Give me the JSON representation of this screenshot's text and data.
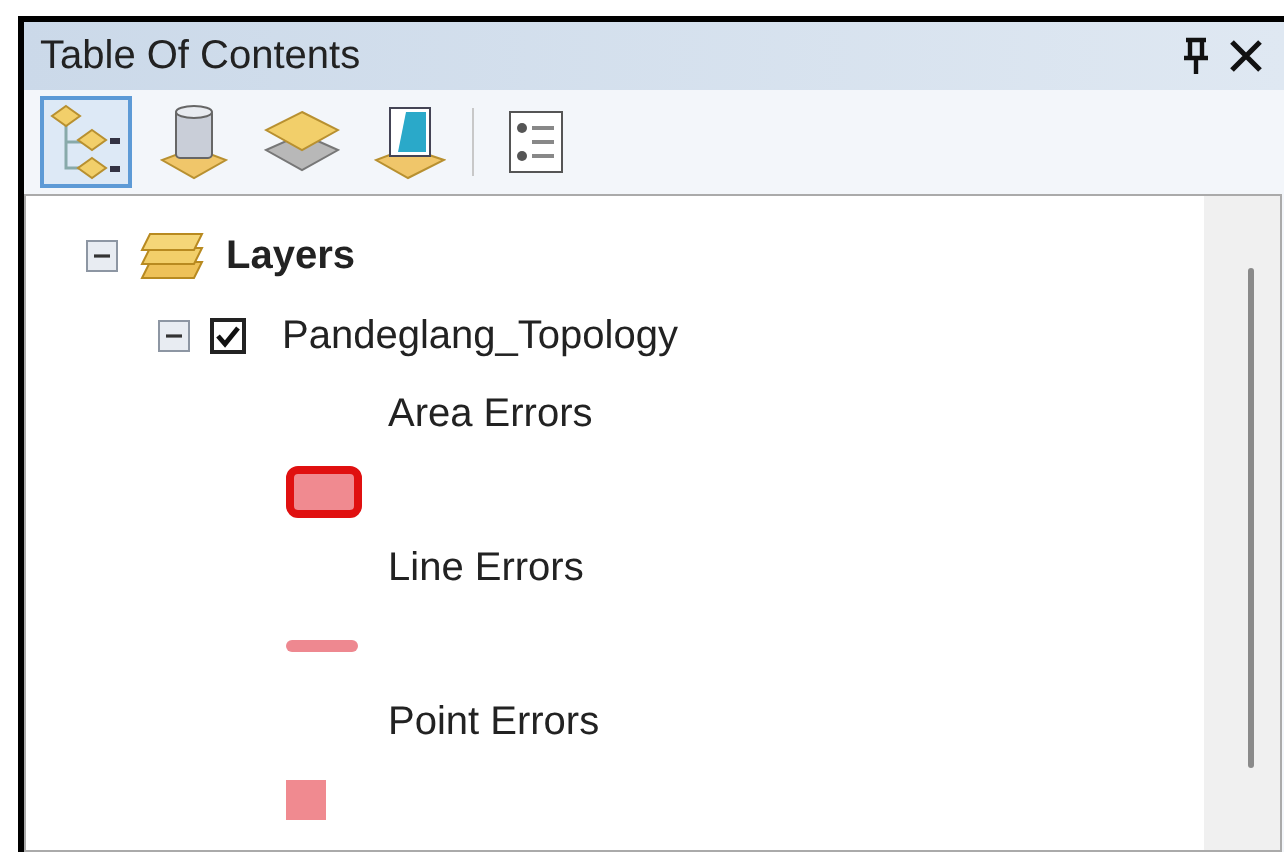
{
  "window": {
    "title": "Table Of Contents"
  },
  "tools": [
    {
      "kind": "drawing-order",
      "selected": true
    },
    {
      "kind": "source",
      "selected": false
    },
    {
      "kind": "visibility",
      "selected": false
    },
    {
      "kind": "selection",
      "selected": false
    },
    {
      "kind": "options",
      "selected": false
    }
  ],
  "tree": {
    "label": "Layers",
    "expanded": true,
    "children": [
      {
        "label": "Pandeglang_Topology",
        "expanded": true,
        "checked": true,
        "children": [
          {
            "label": "Area Errors",
            "kind": "area"
          },
          {
            "label": "Line Errors",
            "kind": "line"
          },
          {
            "label": "Point Errors",
            "kind": "point"
          }
        ]
      }
    ]
  }
}
